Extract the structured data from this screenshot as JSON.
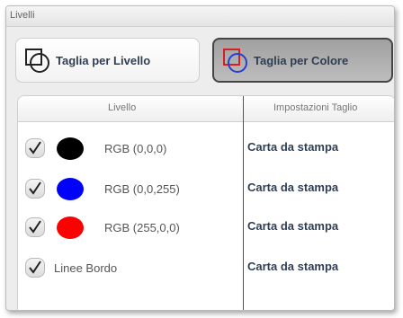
{
  "window": {
    "title": "Livelli"
  },
  "mode_buttons": {
    "by_level_label": "Taglia per Livello",
    "by_color_label": "Taglia per Colore",
    "selected": "Taglia per Colore"
  },
  "table": {
    "columns": [
      "Livello",
      "Impostazioni Taglio"
    ],
    "rows": [
      {
        "checked": true,
        "color": "#000000",
        "label": "RGB (0,0,0)",
        "setting": "Carta da stampa"
      },
      {
        "checked": true,
        "color": "#0000ff",
        "label": "RGB (0,0,255)",
        "setting": "Carta da stampa"
      },
      {
        "checked": true,
        "color": "#ff0000",
        "label": "RGB (255,0,0)",
        "setting": "Carta da stampa"
      },
      {
        "checked": true,
        "color": null,
        "label": "Linee Bordo",
        "setting": "Carta da stampa"
      }
    ]
  },
  "colors": {
    "accent_text": "#2f3e55",
    "selected_button_bg": "#a8a8a8",
    "panel_bg": "#ededed"
  },
  "icons": {
    "level_mode": "layers-icon",
    "color_mode": "color-layers-icon",
    "check": "checkmark-icon"
  }
}
